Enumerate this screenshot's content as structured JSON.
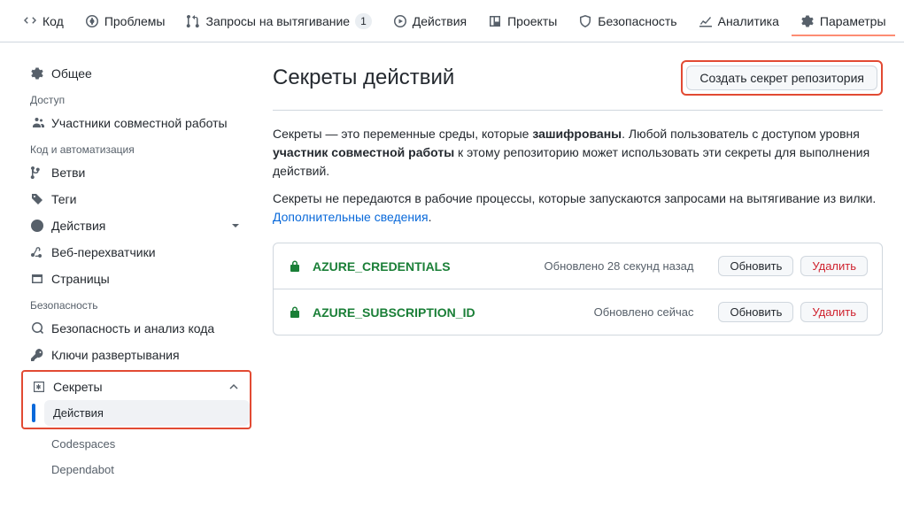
{
  "topnav": {
    "code": "Код",
    "issues": "Проблемы",
    "pulls": "Запросы на вытягивание",
    "pulls_count": "1",
    "actions": "Действия",
    "projects": "Проекты",
    "security": "Безопасность",
    "insights": "Аналитика",
    "settings": "Параметры"
  },
  "sidebar": {
    "general": "Общее",
    "access_title": "Доступ",
    "collaborators": "Участники совместной работы",
    "code_automation_title": "Код и автоматизация",
    "branches": "Ветви",
    "tags": "Теги",
    "actions": "Действия",
    "webhooks": "Веб-перехватчики",
    "pages": "Страницы",
    "security_title": "Безопасность",
    "code_security": "Безопасность и анализ кода",
    "deploy_keys": "Ключи развертывания",
    "secrets": "Секреты",
    "secrets_sub_actions": "Действия",
    "secrets_sub_codespaces": "Codespaces",
    "secrets_sub_dependabot": "Dependabot"
  },
  "page": {
    "title": "Секреты действий",
    "new_secret_btn": "Создать секрет репозитория",
    "desc1_a": "Секреты — это переменные среды, которые ",
    "desc1_b": "зашифрованы",
    "desc1_c": ". Любой пользователь с доступом уровня ",
    "desc1_d": "участник совместной работы",
    "desc1_e": " к этому репозиторию может использовать эти секреты для выполнения действий.",
    "desc2": "Секреты не передаются в рабочие процессы, которые запускаются запросами на вытягивание из вилки.",
    "learn_more": "Дополнительные сведения",
    "update_btn": "Обновить",
    "delete_btn": "Удалить"
  },
  "secrets": [
    {
      "name": "AZURE_CREDENTIALS",
      "updated": "Обновлено 28 секунд назад"
    },
    {
      "name": "AZURE_SUBSCRIPTION_ID",
      "updated": "Обновлено сейчас"
    }
  ]
}
